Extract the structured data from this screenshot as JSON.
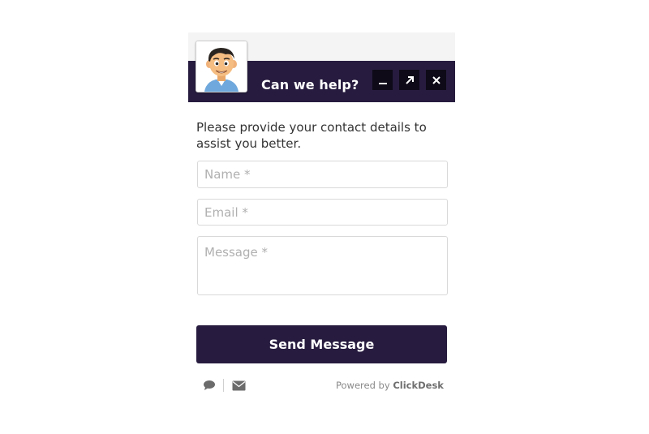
{
  "header": {
    "title": "Can we help?",
    "controls": [
      "minimize-icon",
      "popout-icon",
      "close-icon"
    ],
    "background_color": "#271c3f"
  },
  "form": {
    "intro": "Please provide your contact details to assist you better.",
    "name_placeholder": "Name *",
    "email_placeholder": "Email *",
    "message_placeholder": "Message *",
    "submit_label": "Send Message",
    "button_color": "#271c3f"
  },
  "footer": {
    "icons": [
      "chat-bubble-icon",
      "envelope-icon"
    ],
    "powered_prefix": "Powered by",
    "powered_brand": "ClickDesk"
  }
}
